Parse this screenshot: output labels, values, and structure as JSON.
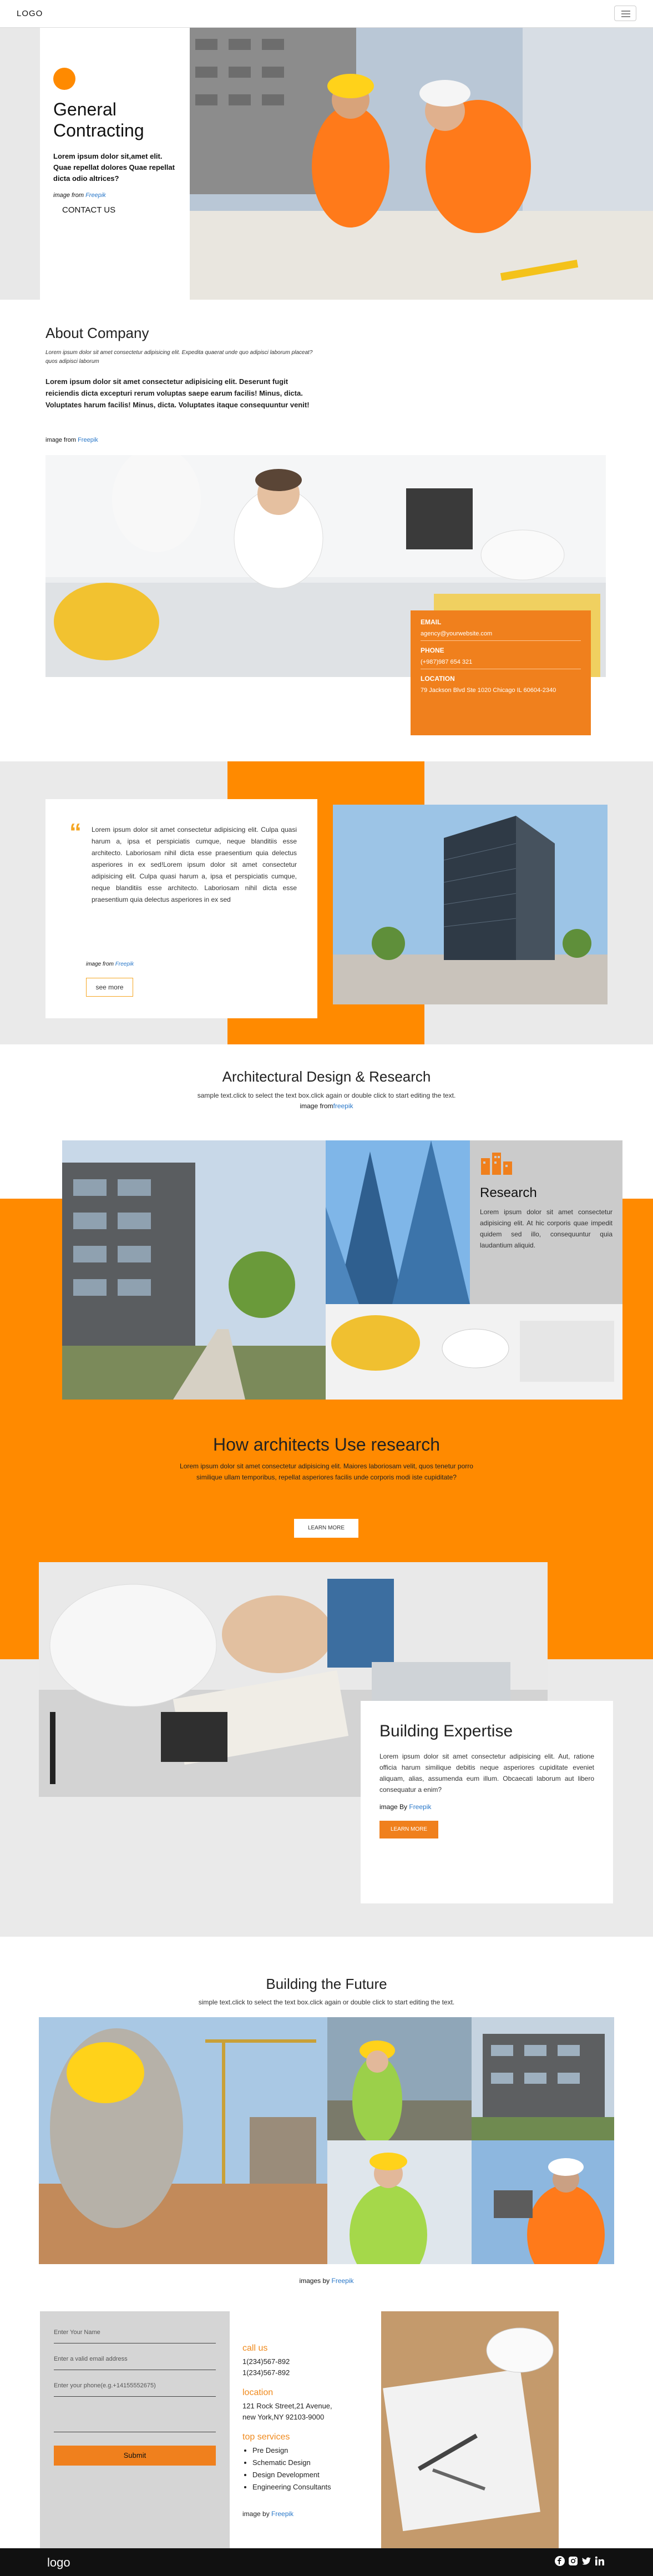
{
  "header": {
    "logo": "LOGO"
  },
  "hero": {
    "title_line1": "General",
    "title_line2": "Contracting",
    "text": "Lorem ipsum dolor sit,amet elit. Quae repellat dolores Quae repellat dicta odio altrices?",
    "credit_prefix": "image from ",
    "credit_link": "Freepik",
    "button": "CONTACT US"
  },
  "about": {
    "title": "About Company",
    "subtitle": "Lorem ipsum dolor sit amet consectetur adipisicing elit. Expedita quaerat unde quo adipisci laborum placeat? quos adipisci laborum",
    "text": "Lorem ipsum dolor sit amet consectetur adipisicing elit. Deserunt fugit reiciendis dicta excepturi rerum voluptas saepe earum facilis! Minus, dicta. Voluptates harum facilis! Minus, dicta. Voluptates itaque consequuntur venit!",
    "credit_prefix": "image from ",
    "credit_link": "Freepik",
    "contact": {
      "email_label": "EMAIL",
      "email": "agency@yourwebsite.com",
      "phone_label": "PHONE",
      "phone": "(+987)987 654 321",
      "location_label": "LOCATION",
      "location": "79 Jackson Blvd Ste 1020 Chicago IL 60604-2340"
    }
  },
  "quote": {
    "text": "Lorem ipsum dolor sit amet consectetur adipisicing elit. Culpa quasi harum a, ipsa et perspiciatis cumque, neque blanditiis esse architecto. Laboriosam nihil dicta esse praesentium quia delectus asperiores in ex sed!Lorem ipsum dolor sit amet consectetur adipisicing elit. Culpa quasi harum a, ipsa et perspiciatis cumque, neque blanditiis esse architecto. Laboriosam nihil dicta esse praesentium quia delectus asperiores in ex sed",
    "credit_prefix": "image from ",
    "credit_link": "Freepik",
    "button": "see more"
  },
  "arch": {
    "title": "Architectural Design & Research",
    "subtitle": "sample text.click to select the text box.click again or double click to start editing the text.",
    "credit_prefix": "image from",
    "credit_link": "freepik",
    "research_title": "Research",
    "research_text": "Lorem ipsum dolor sit amet consectetur adipisicing elit. At hic corporis quae impedit quidem sed illo, consequuntur quia laudantium aliquid."
  },
  "how": {
    "title": "How architects Use research",
    "text": "Lorem ipsum dolor sit amet consectetur adipisicing elit. Maiores laboriosam velit, quos tenetur porro similique ullam temporibus, repellat asperiores facilis unde corporis modi iste cupiditate?",
    "button": "LEARN MORE"
  },
  "expertise": {
    "title": "Building Expertise",
    "text": "Lorem ipsum dolor sit amet consectetur adipisicing elit. Aut, ratione officia harum similique debitis neque asperiores cupiditate eveniet aliquam, alias, assumenda eum illum. Obcaecati laborum aut libero consequatur a enim?",
    "credit_prefix": "image By ",
    "credit_link": "Freepik",
    "button": "LEARN MORE"
  },
  "future": {
    "title": "Building the Future",
    "subtitle": "simple text.click to select the text box.click again or double click to start editing the text.",
    "credit_prefix": "images by ",
    "credit_link": "Freepik"
  },
  "form": {
    "name_placeholder": "Enter Your Name",
    "email_placeholder": "Enter a valid email address",
    "phone_placeholder": "Enter your phone(e.g.+14155552675)",
    "submit": "Submit"
  },
  "info": {
    "call_heading": "call us",
    "phone1": "1(234)567-892",
    "phone2": "1(234)567-892",
    "location_heading": "location",
    "address1": "121 Rock Street,21 Avenue,",
    "address2": "new York,NY 92103-9000",
    "services_heading": "top services",
    "services": [
      "Pre Design",
      "Schematic Design",
      "Design Development",
      "Engineering Consultants"
    ],
    "credit_prefix": "image by ",
    "credit_link": "Freepik"
  },
  "footer": {
    "logo": "logo"
  }
}
